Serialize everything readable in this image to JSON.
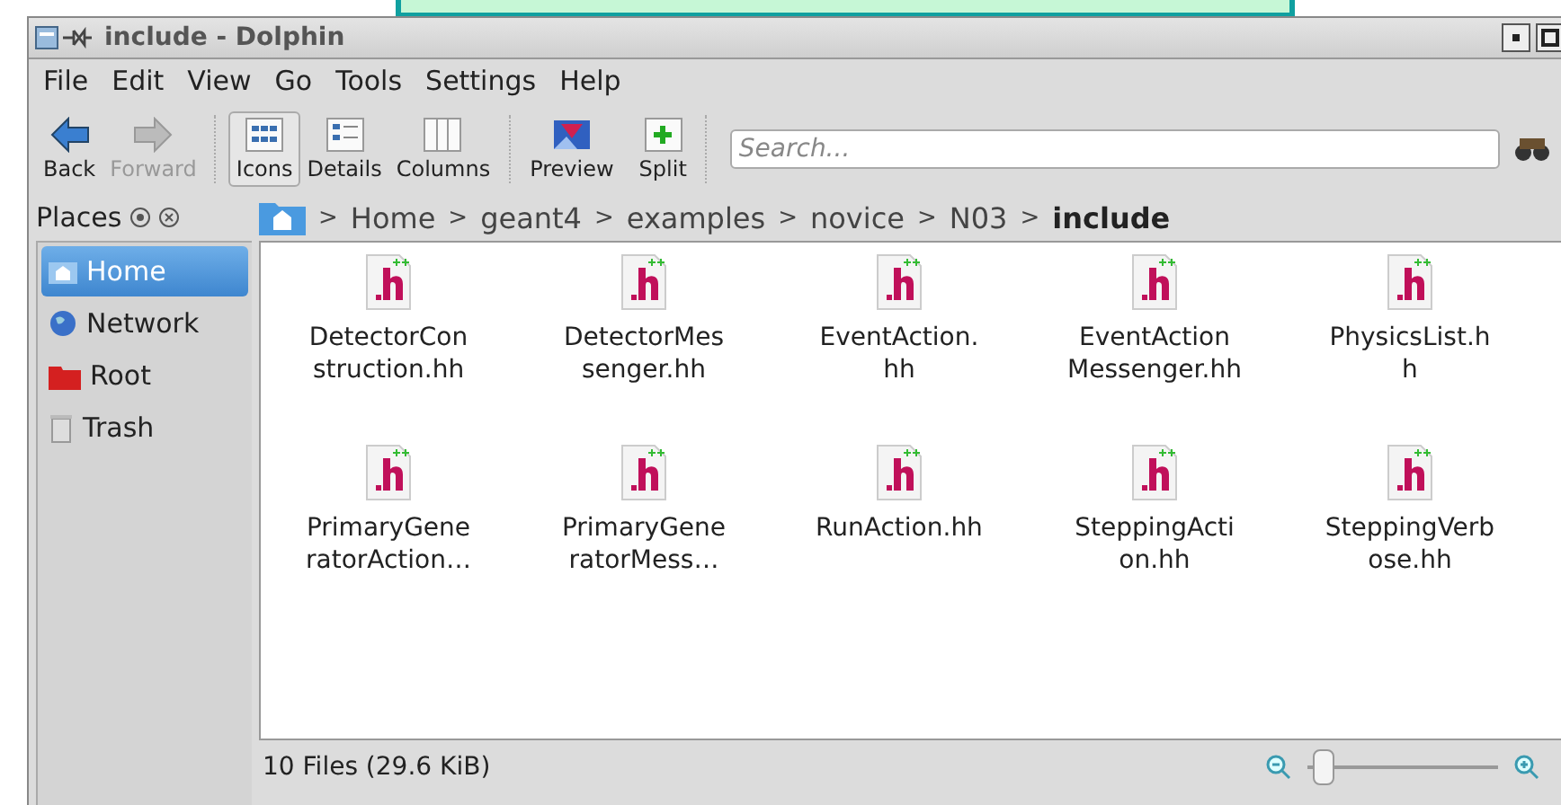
{
  "window": {
    "title": "include - Dolphin"
  },
  "menu": [
    "File",
    "Edit",
    "View",
    "Go",
    "Tools",
    "Settings",
    "Help"
  ],
  "toolbar": {
    "nav": [
      {
        "kind": "back",
        "label": "Back",
        "disabled": false
      },
      {
        "kind": "forward",
        "label": "Forward",
        "disabled": true
      }
    ],
    "views": [
      {
        "kind": "icons",
        "label": "Icons",
        "selected": true
      },
      {
        "kind": "details",
        "label": "Details",
        "selected": false
      },
      {
        "kind": "columns",
        "label": "Columns",
        "selected": false
      }
    ],
    "extras": [
      {
        "kind": "preview",
        "label": "Preview"
      },
      {
        "kind": "split",
        "label": "Split"
      }
    ],
    "search": {
      "placeholder": "Search..."
    }
  },
  "places": {
    "title": "Places",
    "items": [
      {
        "kind": "home",
        "label": "Home",
        "selected": true
      },
      {
        "kind": "network",
        "label": "Network",
        "selected": false
      },
      {
        "kind": "root",
        "label": "Root",
        "selected": false
      },
      {
        "kind": "trash",
        "label": "Trash",
        "selected": false
      }
    ]
  },
  "breadcrumb": {
    "separator": ">",
    "items": [
      "Home",
      "geant4",
      "examples",
      "novice",
      "N03",
      "include"
    ]
  },
  "files": [
    {
      "name": "DetectorCon\nstruction.hh"
    },
    {
      "name": "DetectorMes\nsenger.hh"
    },
    {
      "name": "EventAction.\nhh"
    },
    {
      "name": "EventAction\nMessenger.hh"
    },
    {
      "name": "PhysicsList.h\nh"
    },
    {
      "name": "PrimaryGene\nratorAction…"
    },
    {
      "name": "PrimaryGene\nratorMess…"
    },
    {
      "name": "RunAction.hh"
    },
    {
      "name": "SteppingActi\non.hh"
    },
    {
      "name": "SteppingVerb\nose.hh"
    }
  ],
  "status_bar": {
    "text": "10 Files (29.6 KiB)",
    "zoom": {
      "level": 0.1
    }
  }
}
